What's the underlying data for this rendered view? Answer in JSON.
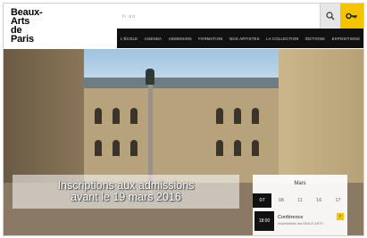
{
  "logo": {
    "lines": [
      "Beaux-",
      "Arts",
      "de",
      "Paris"
    ]
  },
  "header": {
    "lang": "fr  en",
    "search_icon": "search-icon",
    "account_icon": "key-icon",
    "accent_color": "#f5c400"
  },
  "nav": {
    "items": [
      {
        "label": "L'école"
      },
      {
        "label": "Agenda"
      },
      {
        "label": "Admission"
      },
      {
        "label": "Formation"
      },
      {
        "label": "Nos artistes"
      },
      {
        "label": "La collection"
      },
      {
        "label": "Éditions"
      },
      {
        "label": "Expositions"
      }
    ]
  },
  "hero": {
    "caption_line1": "Inscriptions aux admissions",
    "caption_line2": "avant le 19 mars 2016"
  },
  "calendar": {
    "month": "Mars",
    "days": [
      "07",
      "08",
      "11",
      "16",
      "17"
    ],
    "active_day_index": 0,
    "event": {
      "time": "18:00",
      "title": "Conférence",
      "subtitle": "Amphithéâtre des BEAUX-ARTS",
      "arrow": "›"
    }
  }
}
